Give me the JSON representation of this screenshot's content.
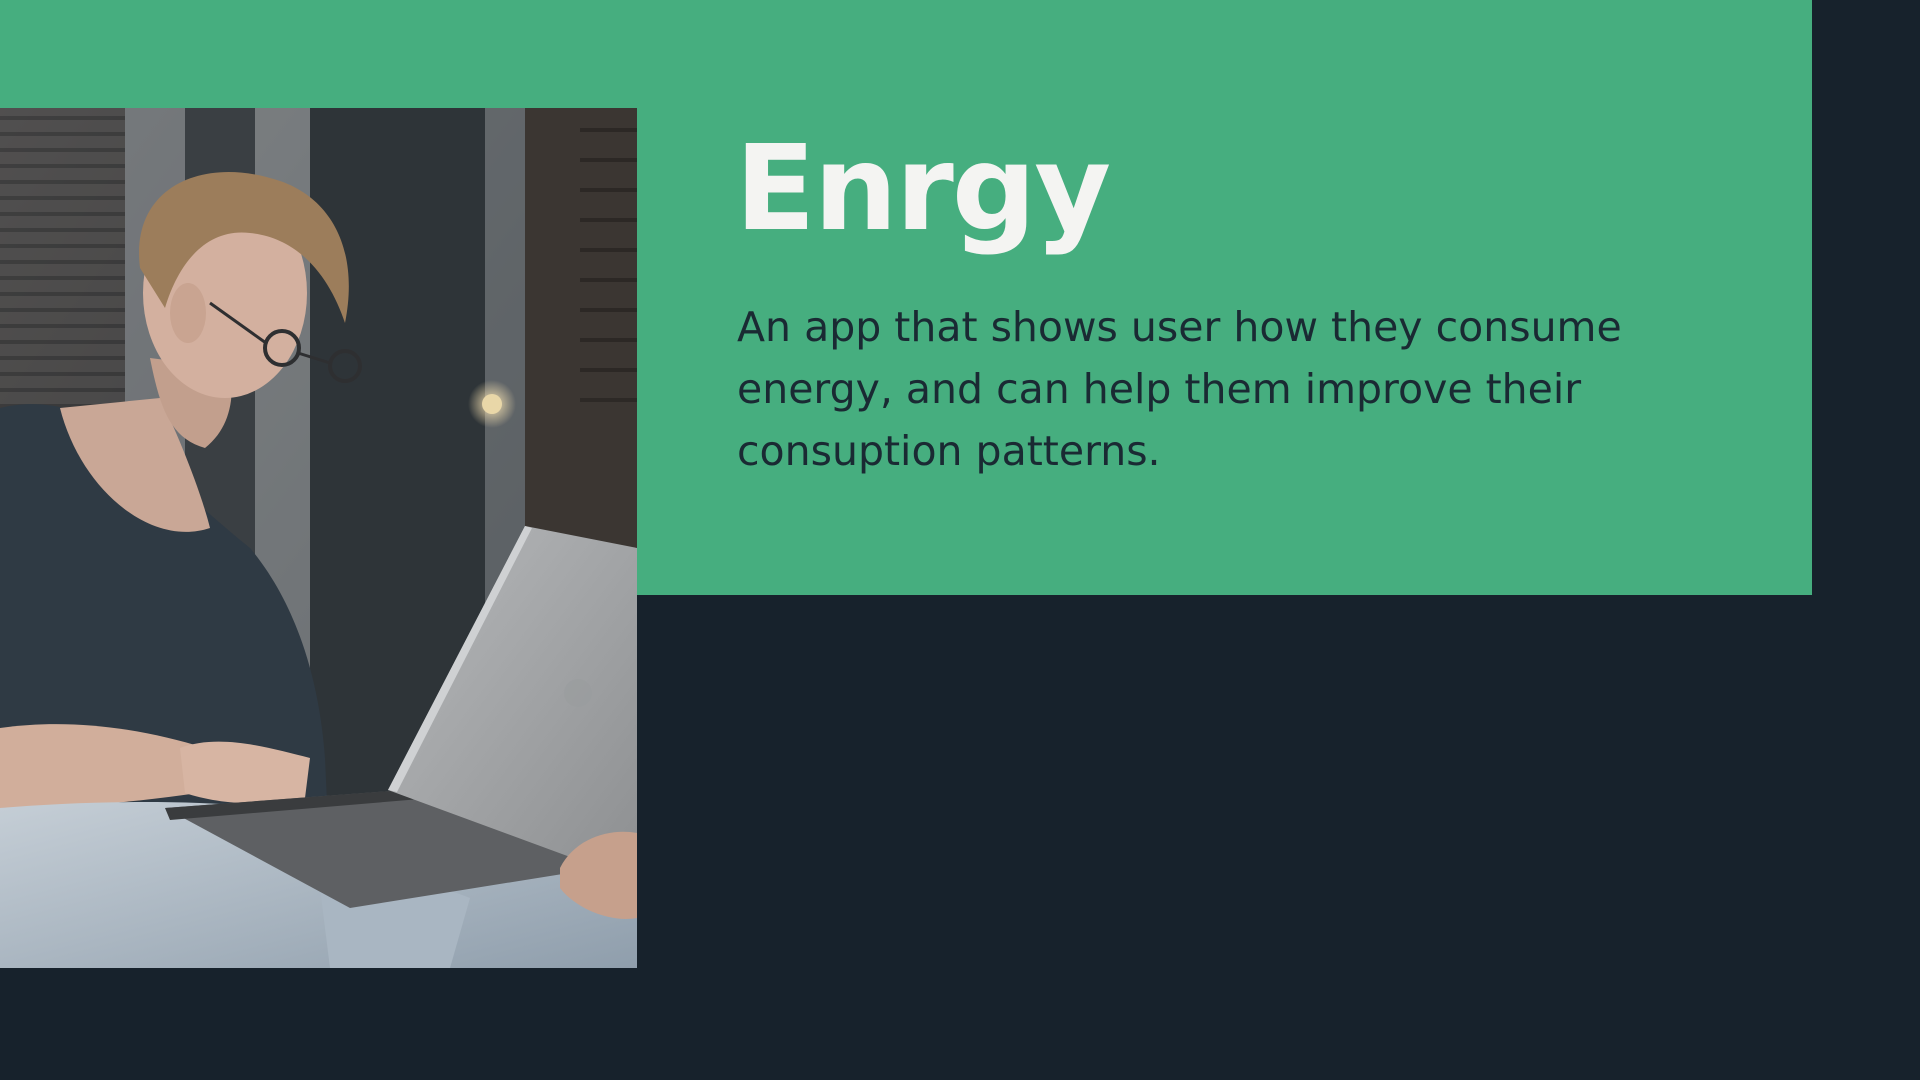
{
  "slide": {
    "title": "Enrgy",
    "description": "An app that shows user how they consume energy, and can help them improve their consuption patterns."
  },
  "colors": {
    "accent_green": "#46ae7f",
    "background_dark": "#17222c",
    "title_text": "#f4f4f2",
    "body_text": "#1a2a33"
  },
  "photo": {
    "subject": "person-using-laptop-photo"
  }
}
